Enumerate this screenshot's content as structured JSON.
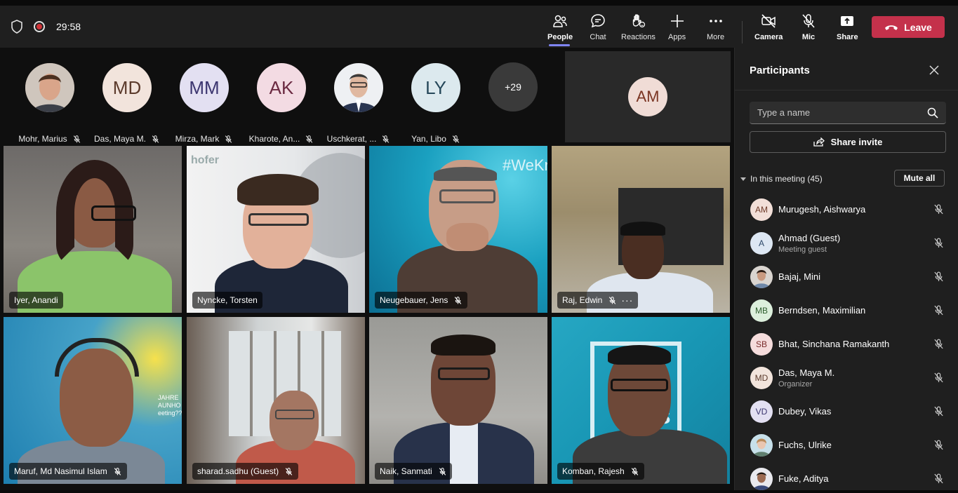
{
  "topbar": {
    "timer": "29:58",
    "buttons": {
      "people": "People",
      "chat": "Chat",
      "reactions": "Reactions",
      "apps": "Apps",
      "more": "More",
      "camera": "Camera",
      "mic": "Mic",
      "share": "Share"
    },
    "leave": "Leave"
  },
  "strip": {
    "items": [
      {
        "name": "Mohr, Marius",
        "initials": ""
      },
      {
        "name": "Das, Maya M.",
        "initials": "MD"
      },
      {
        "name": "Mirza, Mark",
        "initials": "MM"
      },
      {
        "name": "Kharote, An...",
        "initials": "AK"
      },
      {
        "name": "Uschkerat, ...",
        "initials": ""
      },
      {
        "name": "Yan, Libo",
        "initials": "LY"
      }
    ],
    "more_count": "+29",
    "spotlight_initials": "AM"
  },
  "tiles": [
    {
      "name": "Iyer, Anandi"
    },
    {
      "name": "Nyncke, Torsten"
    },
    {
      "name": "Neugebauer, Jens"
    },
    {
      "name": "Raj, Edwin"
    },
    {
      "name": "Maruf, Md Nasimul Islam"
    },
    {
      "name": "sharad.sadhu (Guest)"
    },
    {
      "name": "Naik, Sanmati"
    },
    {
      "name": "Komban, Rajesh"
    }
  ],
  "tile_text": {
    "logo_partial": "hofer",
    "hashtag_partial": "#WeKno",
    "jahre_line1": "JAHRE",
    "jahre_line2": "AUNHO",
    "jahre_line3": "eeting??",
    "banner_line1": "y",
    "banner_line2": "ns"
  },
  "panel": {
    "title": "Participants",
    "search_placeholder": "Type a name",
    "share_invite": "Share invite",
    "in_meeting": "In this meeting (45)",
    "mute_all": "Mute all",
    "participants": [
      {
        "name": "Murugesh, Aishwarya",
        "initials": "AM",
        "sub": ""
      },
      {
        "name": "Ahmad (Guest)",
        "initials": "A",
        "sub": "Meeting guest"
      },
      {
        "name": "Bajaj, Mini",
        "initials": "",
        "sub": ""
      },
      {
        "name": "Berndsen, Maximilian",
        "initials": "MB",
        "sub": ""
      },
      {
        "name": "Bhat, Sinchana Ramakanth",
        "initials": "SB",
        "sub": ""
      },
      {
        "name": "Das, Maya M.",
        "initials": "MD",
        "sub": "Organizer"
      },
      {
        "name": "Dubey, Vikas",
        "initials": "VD",
        "sub": ""
      },
      {
        "name": "Fuchs, Ulrike",
        "initials": "",
        "sub": ""
      },
      {
        "name": "Fuke, Aditya",
        "initials": "",
        "sub": ""
      }
    ]
  },
  "colors": {
    "accent": "#7f85f5",
    "leave": "#c4314b",
    "topbar": "#1f1f1f",
    "panel": "#1f1f1f"
  }
}
